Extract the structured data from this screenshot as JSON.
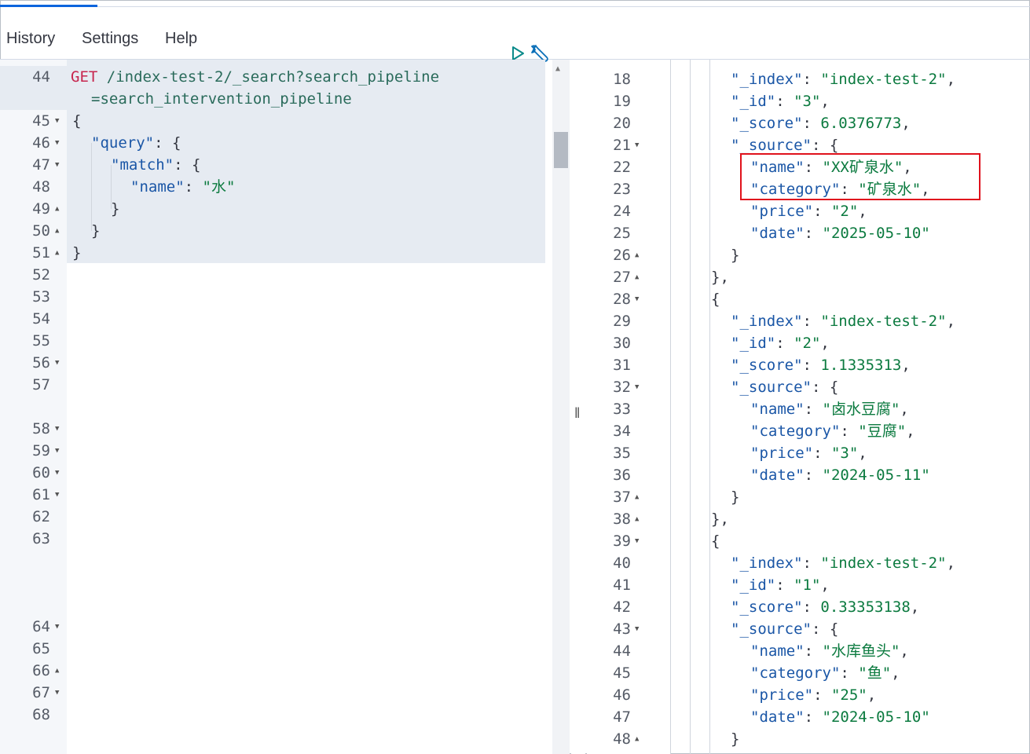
{
  "menu": {
    "history": "History",
    "settings": "Settings",
    "help": "Help"
  },
  "toolbar": {
    "run_icon": "play-icon",
    "settings_icon": "wrench-icon"
  },
  "request": {
    "method": "GET",
    "path_line1": " /index-test-2/_search?search_pipeline",
    "path_line2": "=search_intervention_pipeline",
    "l45": "{",
    "l46_key": "\"query\"",
    "l46_rest": ": {",
    "l47_key": "\"match\"",
    "l47_rest": ": {",
    "l48_key": "\"name\"",
    "l48_sep": ": ",
    "l48_val": "\"水\"",
    "l49": "}",
    "l50": "}",
    "l51": "}"
  },
  "left_line_numbers": [
    "44",
    "45",
    "46",
    "47",
    "48",
    "49",
    "50",
    "51",
    "52",
    "53",
    "54",
    "55",
    "56",
    "57",
    "58",
    "59",
    "60",
    "61",
    "62",
    "63",
    "64",
    "65",
    "66",
    "67",
    "68"
  ],
  "response": [
    {
      "n": "18",
      "k": "\"_index\"",
      "v": "\"index-test-2\"",
      "e": ","
    },
    {
      "n": "19",
      "k": "\"_id\"",
      "v": "\"3\"",
      "e": ","
    },
    {
      "n": "20",
      "k": "\"_score\"",
      "v": "6.0376773",
      "e": ","
    },
    {
      "n": "21",
      "k": "\"_source\"",
      "v": "{",
      "e": ""
    },
    {
      "n": "22",
      "k": "\"name\"",
      "v": "\"XX矿泉水\"",
      "e": ","
    },
    {
      "n": "23",
      "k": "\"category\"",
      "v": "\"矿泉水\"",
      "e": ","
    },
    {
      "n": "24",
      "k": "\"price\"",
      "v": "\"2\"",
      "e": ","
    },
    {
      "n": "25",
      "k": "\"date\"",
      "v": "\"2025-05-10\"",
      "e": ""
    },
    {
      "n": "26",
      "t": "}"
    },
    {
      "n": "27",
      "t": "},"
    },
    {
      "n": "28",
      "t": "{"
    },
    {
      "n": "29",
      "k": "\"_index\"",
      "v": "\"index-test-2\"",
      "e": ","
    },
    {
      "n": "30",
      "k": "\"_id\"",
      "v": "\"2\"",
      "e": ","
    },
    {
      "n": "31",
      "k": "\"_score\"",
      "v": "1.1335313",
      "e": ","
    },
    {
      "n": "32",
      "k": "\"_source\"",
      "v": "{",
      "e": ""
    },
    {
      "n": "33",
      "k": "\"name\"",
      "v": "\"卤水豆腐\"",
      "e": ","
    },
    {
      "n": "34",
      "k": "\"category\"",
      "v": "\"豆腐\"",
      "e": ","
    },
    {
      "n": "35",
      "k": "\"price\"",
      "v": "\"3\"",
      "e": ","
    },
    {
      "n": "36",
      "k": "\"date\"",
      "v": "\"2024-05-11\"",
      "e": ""
    },
    {
      "n": "37",
      "t": "}"
    },
    {
      "n": "38",
      "t": "},"
    },
    {
      "n": "39",
      "t": "{"
    },
    {
      "n": "40",
      "k": "\"_index\"",
      "v": "\"index-test-2\"",
      "e": ","
    },
    {
      "n": "41",
      "k": "\"_id\"",
      "v": "\"1\"",
      "e": ","
    },
    {
      "n": "42",
      "k": "\"_score\"",
      "v": "0.33353138",
      "e": ","
    },
    {
      "n": "43",
      "k": "\"_source\"",
      "v": "{",
      "e": ""
    },
    {
      "n": "44",
      "k": "\"name\"",
      "v": "\"水库鱼头\"",
      "e": ","
    },
    {
      "n": "45",
      "k": "\"category\"",
      "v": "\"鱼\"",
      "e": ","
    },
    {
      "n": "46",
      "k": "\"price\"",
      "v": "\"25\"",
      "e": ","
    },
    {
      "n": "47",
      "k": "\"date\"",
      "v": "\"2024-05-10\"",
      "e": ""
    },
    {
      "n": "48",
      "t": "}"
    }
  ]
}
